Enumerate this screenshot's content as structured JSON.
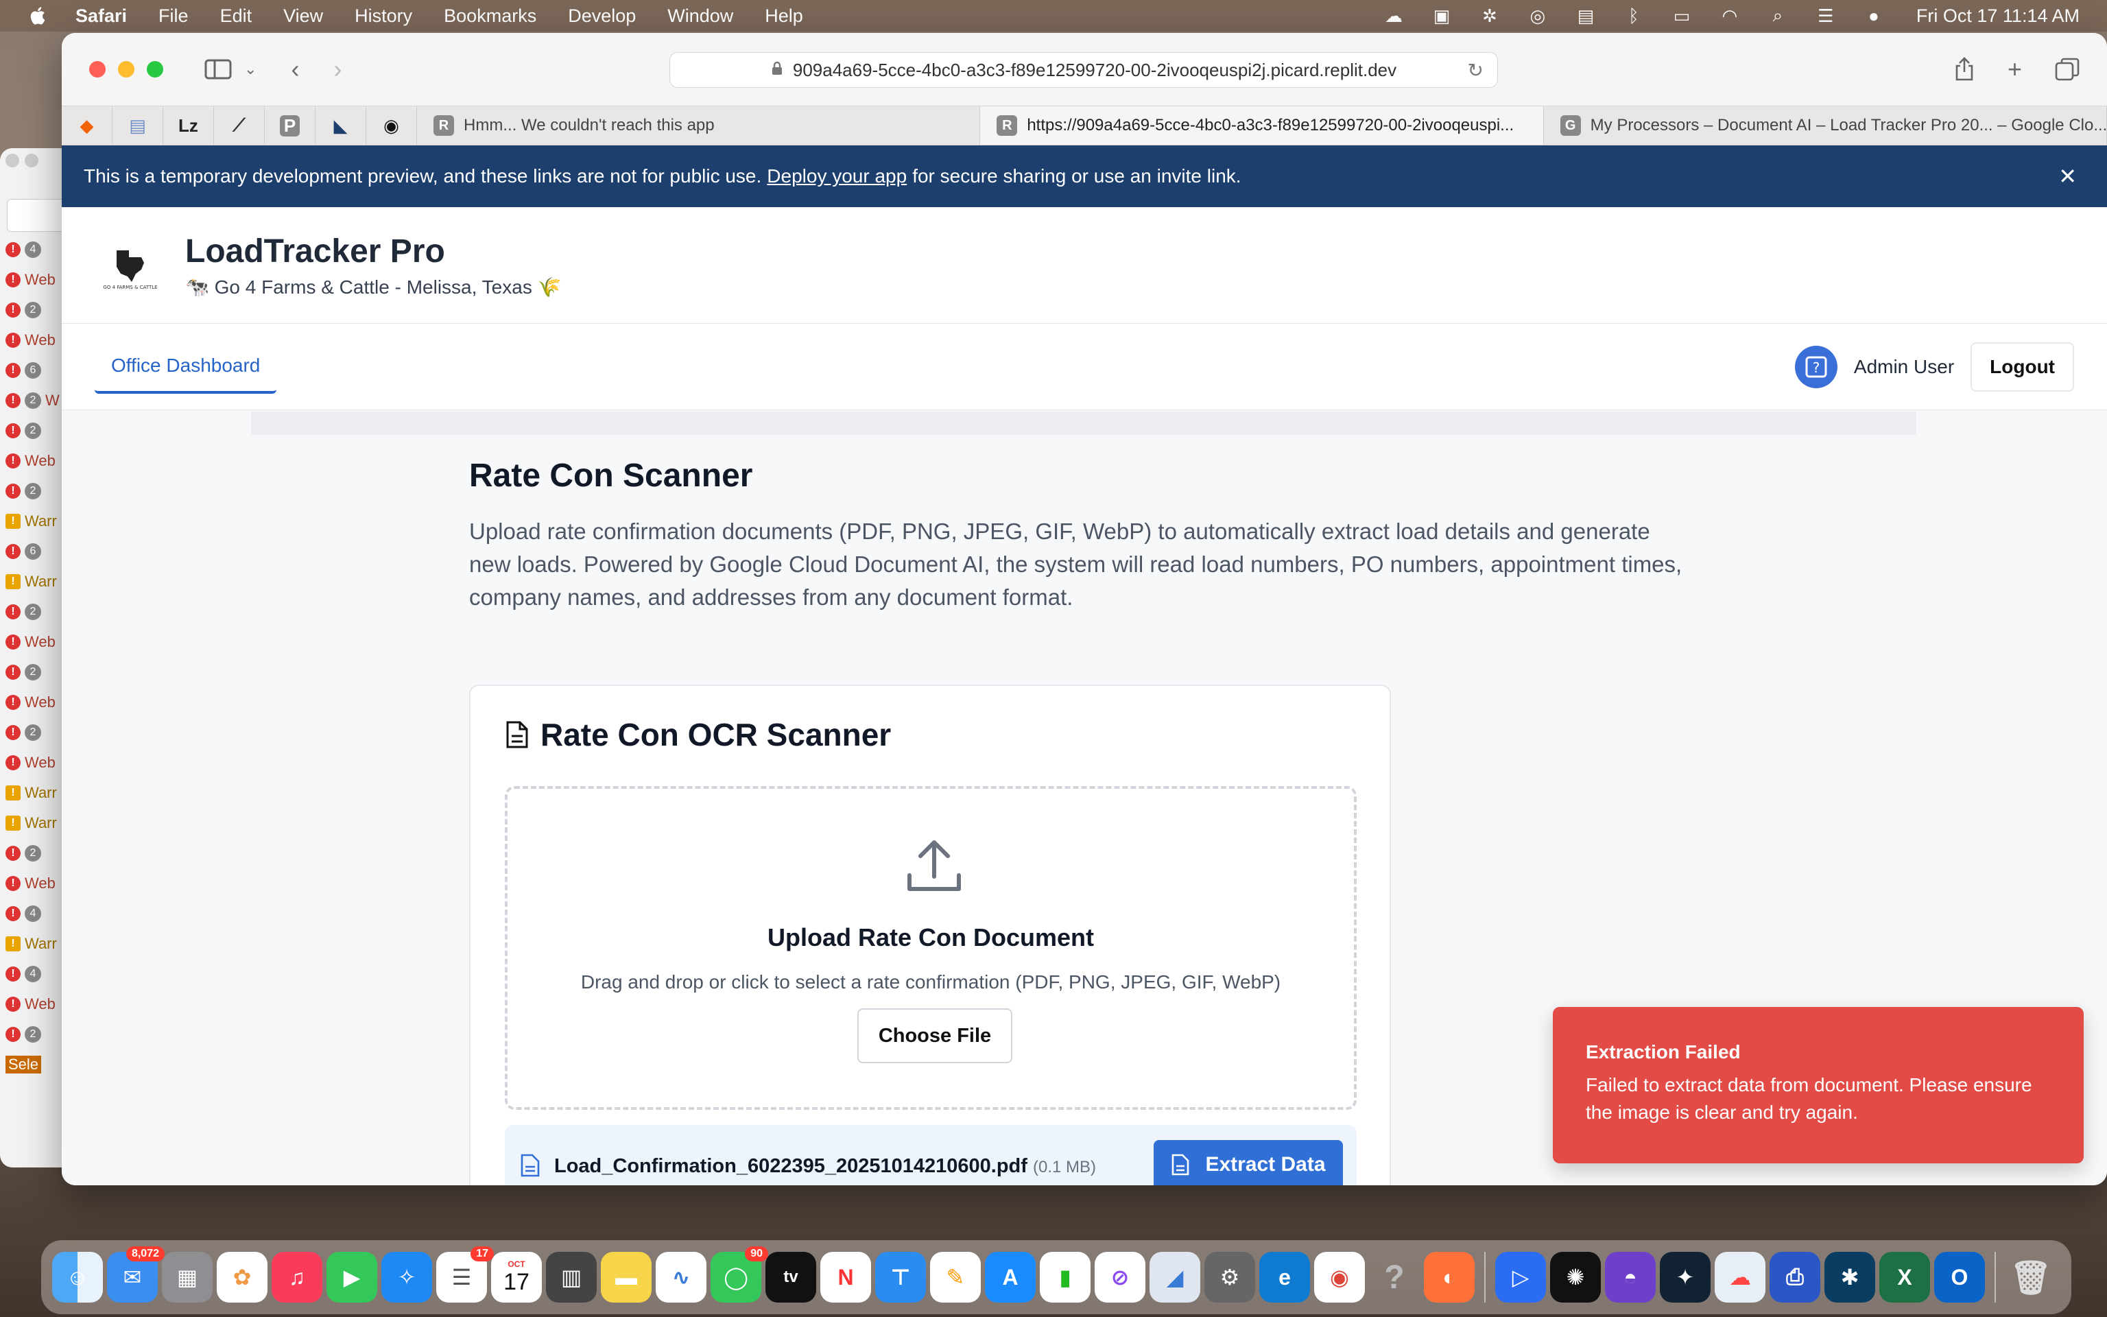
{
  "menubar": {
    "app": "Safari",
    "items": [
      "File",
      "Edit",
      "View",
      "History",
      "Bookmarks",
      "Develop",
      "Window",
      "Help"
    ],
    "clock": "Fri Oct 17  11:14 AM"
  },
  "browser": {
    "url": "909a4a69-5cce-4bc0-a3c3-f89e12599720-00-2ivooqeuspi2j.picard.replit.dev",
    "tabs": [
      {
        "favicon": "R",
        "title": "Hmm... We couldn't reach this app"
      },
      {
        "favicon": "R",
        "title": "https://909a4a69-5cce-4bc0-a3c3-f89e12599720-00-2ivooqeuspi..."
      },
      {
        "favicon": "G",
        "title": "My Processors – Document AI – Load Tracker Pro 20... – Google Clo..."
      }
    ],
    "pinned": [
      "P"
    ]
  },
  "banner": {
    "text_before": "This is a temporary development preview, and these links are not for public use.",
    "link": "Deploy your app",
    "text_after": "for secure sharing or use an invite link.",
    "close": "✕"
  },
  "header": {
    "title": "LoadTracker Pro",
    "subtitle": "🐄 Go 4 Farms & Cattle - Melissa, Texas 🌾"
  },
  "nav": {
    "active_tab": "Office Dashboard",
    "user": "Admin User",
    "logout": "Logout"
  },
  "main": {
    "title": "Rate Con Scanner",
    "description": "Upload rate confirmation documents (PDF, PNG, JPEG, GIF, WebP) to automatically extract load details and generate new loads. Powered by Google Cloud Document AI, the system will read load numbers, PO numbers, appointment times, company names, and addresses from any document format."
  },
  "scanner": {
    "title": "Rate Con OCR Scanner",
    "upload_title": "Upload Rate Con Document",
    "upload_hint": "Drag and drop or click to select a rate confirmation (PDF, PNG, JPEG, GIF, WebP)",
    "choose_file": "Choose File",
    "file_name": "Load_Confirmation_6022395_20251014210600.pdf",
    "file_size": "(0.1 MB)",
    "extract": "Extract Data"
  },
  "toast": {
    "title": "Extraction Failed",
    "message": "Failed to extract data from document. Please ensure the image is clear and try again."
  },
  "dock": {
    "mail_badge": "8,072",
    "reminders_badge": "17",
    "calendar_month": "OCT",
    "calendar_day": "17",
    "messages_badge": "90"
  },
  "inspector": {
    "rows": [
      {
        "type": "error",
        "count": "4",
        "label": ""
      },
      {
        "type": "error",
        "count": "",
        "label": "Web"
      },
      {
        "type": "error",
        "count": "2",
        "label": ""
      },
      {
        "type": "error",
        "count": "",
        "label": "Web"
      },
      {
        "type": "error",
        "count": "6",
        "label": ""
      },
      {
        "type": "error",
        "count": "2",
        "label": "W"
      },
      {
        "type": "error",
        "count": "2",
        "label": ""
      },
      {
        "type": "error",
        "count": "",
        "label": "Web"
      },
      {
        "type": "error",
        "count": "2",
        "label": ""
      },
      {
        "type": "warn",
        "count": "",
        "label": "Warr"
      },
      {
        "type": "error",
        "count": "6",
        "label": ""
      },
      {
        "type": "warn",
        "count": "",
        "label": "Warr"
      },
      {
        "type": "error",
        "count": "2",
        "label": ""
      },
      {
        "type": "error",
        "count": "",
        "label": "Web"
      },
      {
        "type": "error",
        "count": "2",
        "label": ""
      },
      {
        "type": "error",
        "count": "",
        "label": "Web"
      },
      {
        "type": "error",
        "count": "2",
        "label": ""
      },
      {
        "type": "error",
        "count": "",
        "label": "Web"
      },
      {
        "type": "warn",
        "count": "",
        "label": "Warr"
      },
      {
        "type": "warn",
        "count": "",
        "label": "Warr"
      },
      {
        "type": "error",
        "count": "2",
        "label": ""
      },
      {
        "type": "error",
        "count": "",
        "label": "Web"
      },
      {
        "type": "error",
        "count": "4",
        "label": ""
      },
      {
        "type": "warn",
        "count": "",
        "label": "Warr"
      },
      {
        "type": "error",
        "count": "4",
        "label": ""
      },
      {
        "type": "error",
        "count": "",
        "label": "Web"
      },
      {
        "type": "error",
        "count": "2",
        "label": ""
      }
    ],
    "select_label": "Sele"
  },
  "colors": {
    "banner": "#1d3f6e",
    "accent": "#2f6fd6",
    "toast": "#e24b46"
  }
}
